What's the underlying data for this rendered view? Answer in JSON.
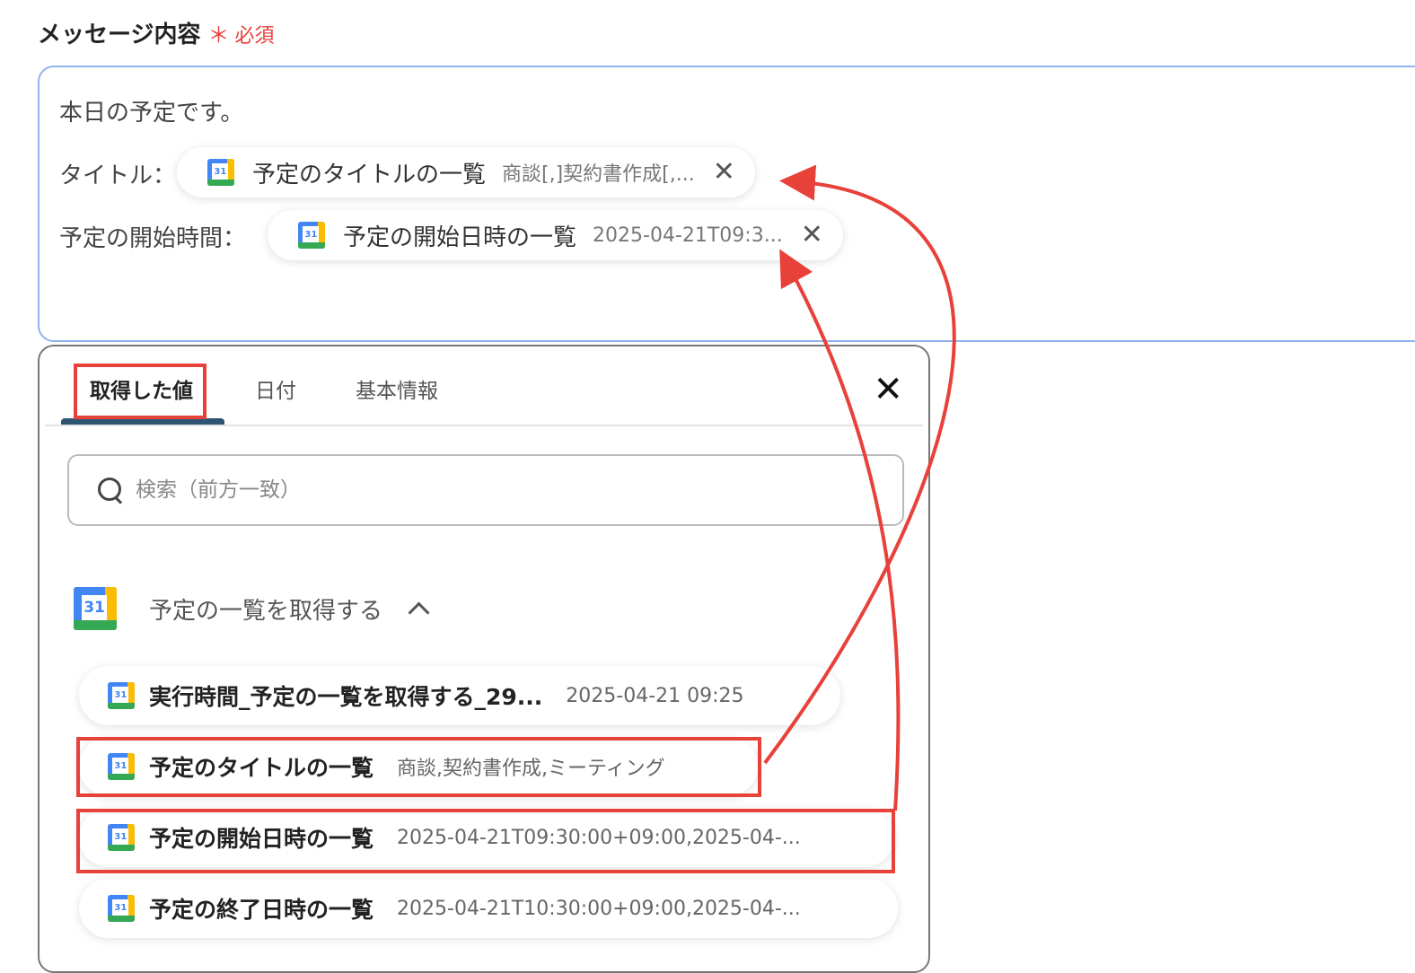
{
  "field": {
    "label": "メッセージ内容",
    "required_mark": "＊",
    "required_text": "必須"
  },
  "editor": {
    "line1": "本日の予定です。",
    "title_prefix": "タイトル：",
    "start_prefix": "予定の開始時間：",
    "chips": [
      {
        "icon": "google-calendar-icon",
        "name": "予定のタイトルの一覧",
        "value": "商談[,]契約書作成[,...",
        "close": "✕"
      },
      {
        "icon": "google-calendar-icon",
        "name": "予定の開始日時の一覧",
        "value": "2025-04-21T09:3...",
        "close": "✕"
      }
    ]
  },
  "panel": {
    "tabs": [
      "取得した値",
      "日付",
      "基本情報"
    ],
    "active_tab": 0,
    "close": "✕",
    "search_placeholder": "検索（前方一致）",
    "group": {
      "icon": "google-calendar-icon",
      "icon_text": "31",
      "title": "予定の一覧を取得する"
    },
    "items": [
      {
        "name": "実行時間_予定の一覧を取得する_29...",
        "value": "2025-04-21 09:25"
      },
      {
        "name": "予定のタイトルの一覧",
        "value": "商談,契約書作成,ミーティング"
      },
      {
        "name": "予定の開始日時の一覧",
        "value": "2025-04-21T09:30:00+09:00,2025-04-..."
      },
      {
        "name": "予定の終了日時の一覧",
        "value": "2025-04-21T10:30:00+09:00,2025-04-..."
      }
    ]
  },
  "calendar_icon_text": "31",
  "colors": {
    "annotation": "#e8413a",
    "editor_border": "#8fb3ee",
    "tab_underline": "#2d5572",
    "gcal_blue": "#4285f4",
    "gcal_yellow": "#fbbc04",
    "gcal_green": "#34a853"
  }
}
